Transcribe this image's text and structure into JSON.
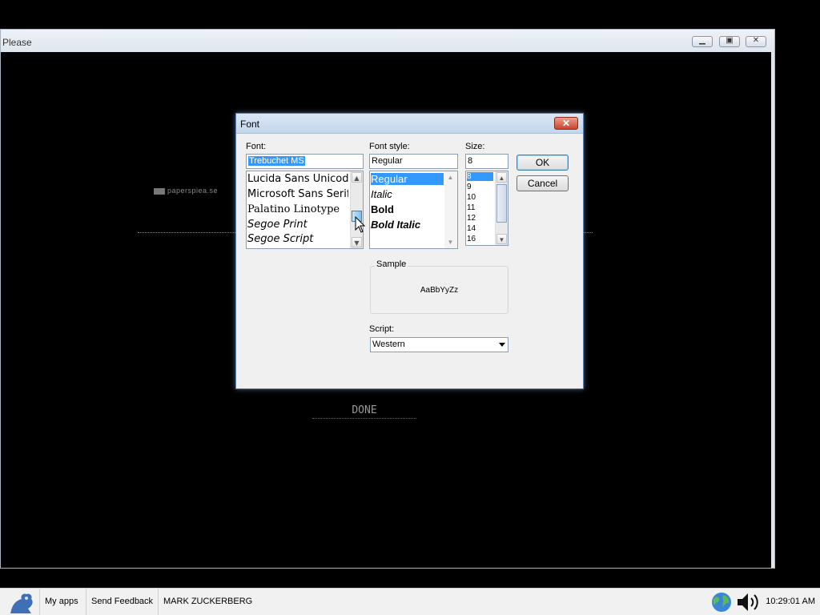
{
  "window": {
    "title": "Please",
    "controls": [
      "minimize",
      "maximize",
      "close"
    ]
  },
  "page": {
    "logo_text": "paperspiea.se",
    "done_label": "DONE"
  },
  "dialog": {
    "title": "Font",
    "close_glyph": "✕",
    "font_label": "Font:",
    "font_value": "Trebuchet MS",
    "font_list": [
      "Lucida Sans Unicode",
      "Microsoft Sans Serif",
      "Palatino Linotype",
      "Segoe Print",
      "Segoe Script"
    ],
    "style_label": "Font style:",
    "style_value": "Regular",
    "style_list": [
      "Regular",
      "Italic",
      "Bold",
      "Bold Italic"
    ],
    "size_label": "Size:",
    "size_value": "8",
    "size_list": [
      "8",
      "9",
      "10",
      "11",
      "12",
      "14",
      "16"
    ],
    "ok_label": "OK",
    "cancel_label": "Cancel",
    "sample_label": "Sample",
    "sample_text": "AaBbYyZz",
    "script_label": "Script:",
    "script_value": "Western"
  },
  "taskbar": {
    "my_apps": "My apps",
    "send_feedback": "Send Feedback",
    "user": "MARK ZUCKERBERG",
    "clock": "10:29:01 AM",
    "icons": [
      "app-logo-icon",
      "globe-icon",
      "speaker-icon"
    ]
  },
  "colors": {
    "selection": "#3399ff",
    "dialog_bg": "#f0f0f0",
    "close_button": "#c9452b"
  }
}
